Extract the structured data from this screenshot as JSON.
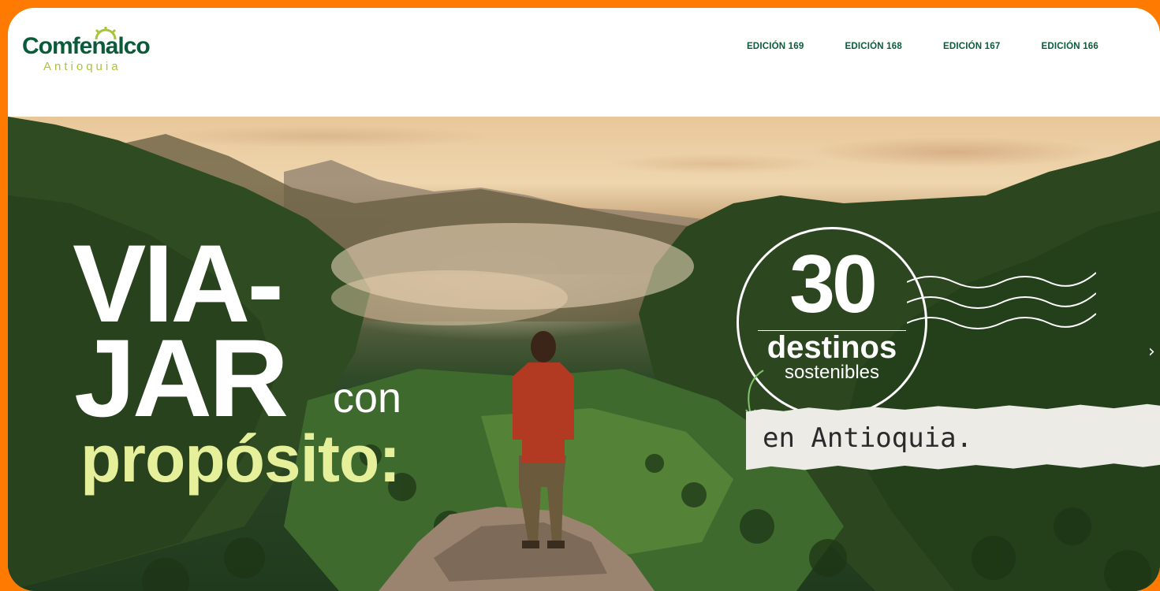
{
  "brand": {
    "name": "Comfenalco",
    "region": "Antioquia",
    "primary_color": "#0b5b3a",
    "accent_color": "#a8c539",
    "frame_color": "#ff7a00"
  },
  "nav": {
    "items": [
      {
        "label": "EDICIÓN 169"
      },
      {
        "label": "EDICIÓN 168"
      },
      {
        "label": "EDICIÓN 167"
      },
      {
        "label": "EDICIÓN 166"
      }
    ]
  },
  "hero": {
    "title_line1": "VIA-",
    "title_line2": "JAR",
    "title_connector": "con",
    "title_line3": "propósito:",
    "badge_number": "30",
    "badge_word": "destinos",
    "badge_sub": "sostenibles",
    "location": "en Antioquia.",
    "next_icon": "chevron-right-icon"
  }
}
